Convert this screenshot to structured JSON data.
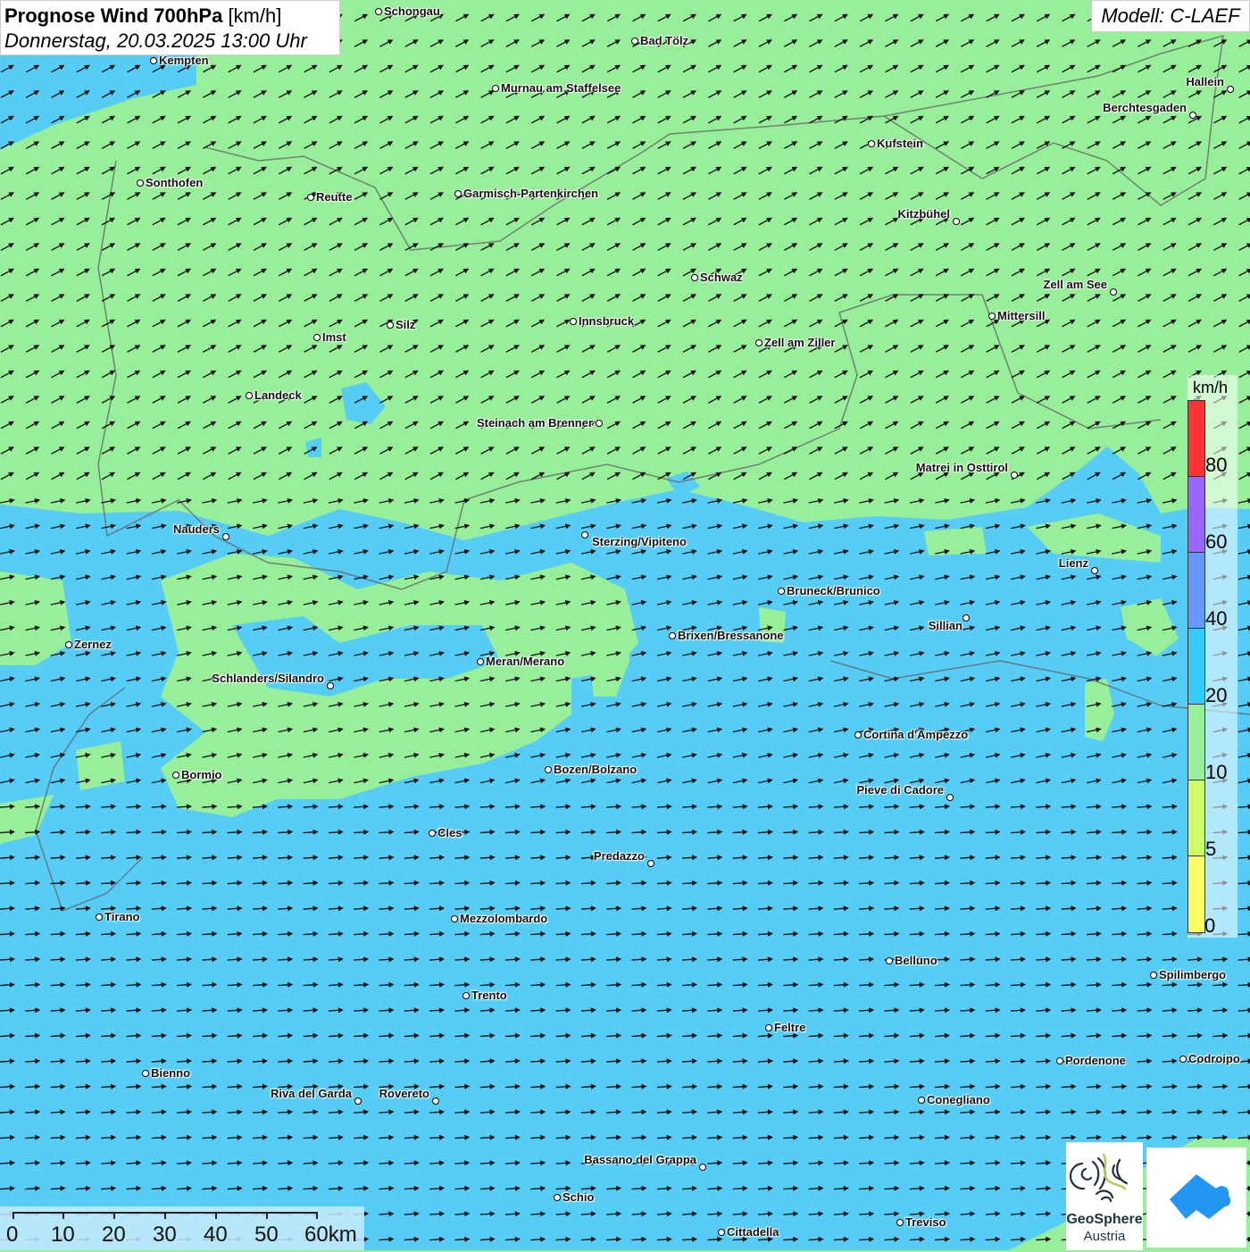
{
  "title": {
    "main_bold": "Prognose Wind 700hPa",
    "main_unit": "[km/h]",
    "datetime": "Donnerstag, 20.03.2025 13:00 Uhr"
  },
  "model": "Modell: C-LAEF",
  "colors": {
    "calm_green": "#98ef9a",
    "wind_blue": "#55cdf6",
    "border": "#666666"
  },
  "cities": [
    "Schongau",
    "Bad Tölz",
    "Kempten",
    "Murnau am Staffelsee",
    "Hallein",
    "Berchtesgaden",
    "Kufstein",
    "Sonthofen",
    "Reutte",
    "Garmisch-Partenkirchen",
    "Kitzbühel",
    "Schwaz",
    "Zell am See",
    "Mittersill",
    "Innsbruck",
    "Silz",
    "Imst",
    "Zell am Ziller",
    "Landeck",
    "Steinach am Brenner",
    "Matrei in Osttirol",
    "Nauders",
    "Sterzing/Vipiteno",
    "Lienz",
    "Bruneck/Brunico",
    "Sillian",
    "Brixen/Bressanone",
    "Zernez",
    "Meran/Merano",
    "Schlanders/Silandro",
    "Cortina d'Ampezzo",
    "Bozen/Bolzano",
    "Bormio",
    "Pieve di Cadore",
    "Cles",
    "Predazzo",
    "Tirano",
    "Mezzolombardo",
    "Belluno",
    "Spilimbergo",
    "Trento",
    "Feltre",
    "Pordenone",
    "Codroipo",
    "Bienno",
    "Riva del Garda",
    "Rovereto",
    "Conegliano",
    "Bassano del Grappa",
    "Schio",
    "Treviso",
    "Cittadella"
  ],
  "legend": {
    "unit": "km/h",
    "ticks": [
      "80",
      "60",
      "40",
      "20",
      "10",
      "5",
      "0"
    ],
    "colors": [
      "#ff3333",
      "#9966ff",
      "#6699ff",
      "#33ccff",
      "#99f09a",
      "#ccff66",
      "#ffff66"
    ]
  },
  "scale": {
    "labels": [
      "0",
      "10",
      "20",
      "30",
      "40",
      "50",
      "60km"
    ]
  },
  "logos": {
    "geosphere_line1": "GeoSphere",
    "geosphere_line2": "Austria"
  }
}
